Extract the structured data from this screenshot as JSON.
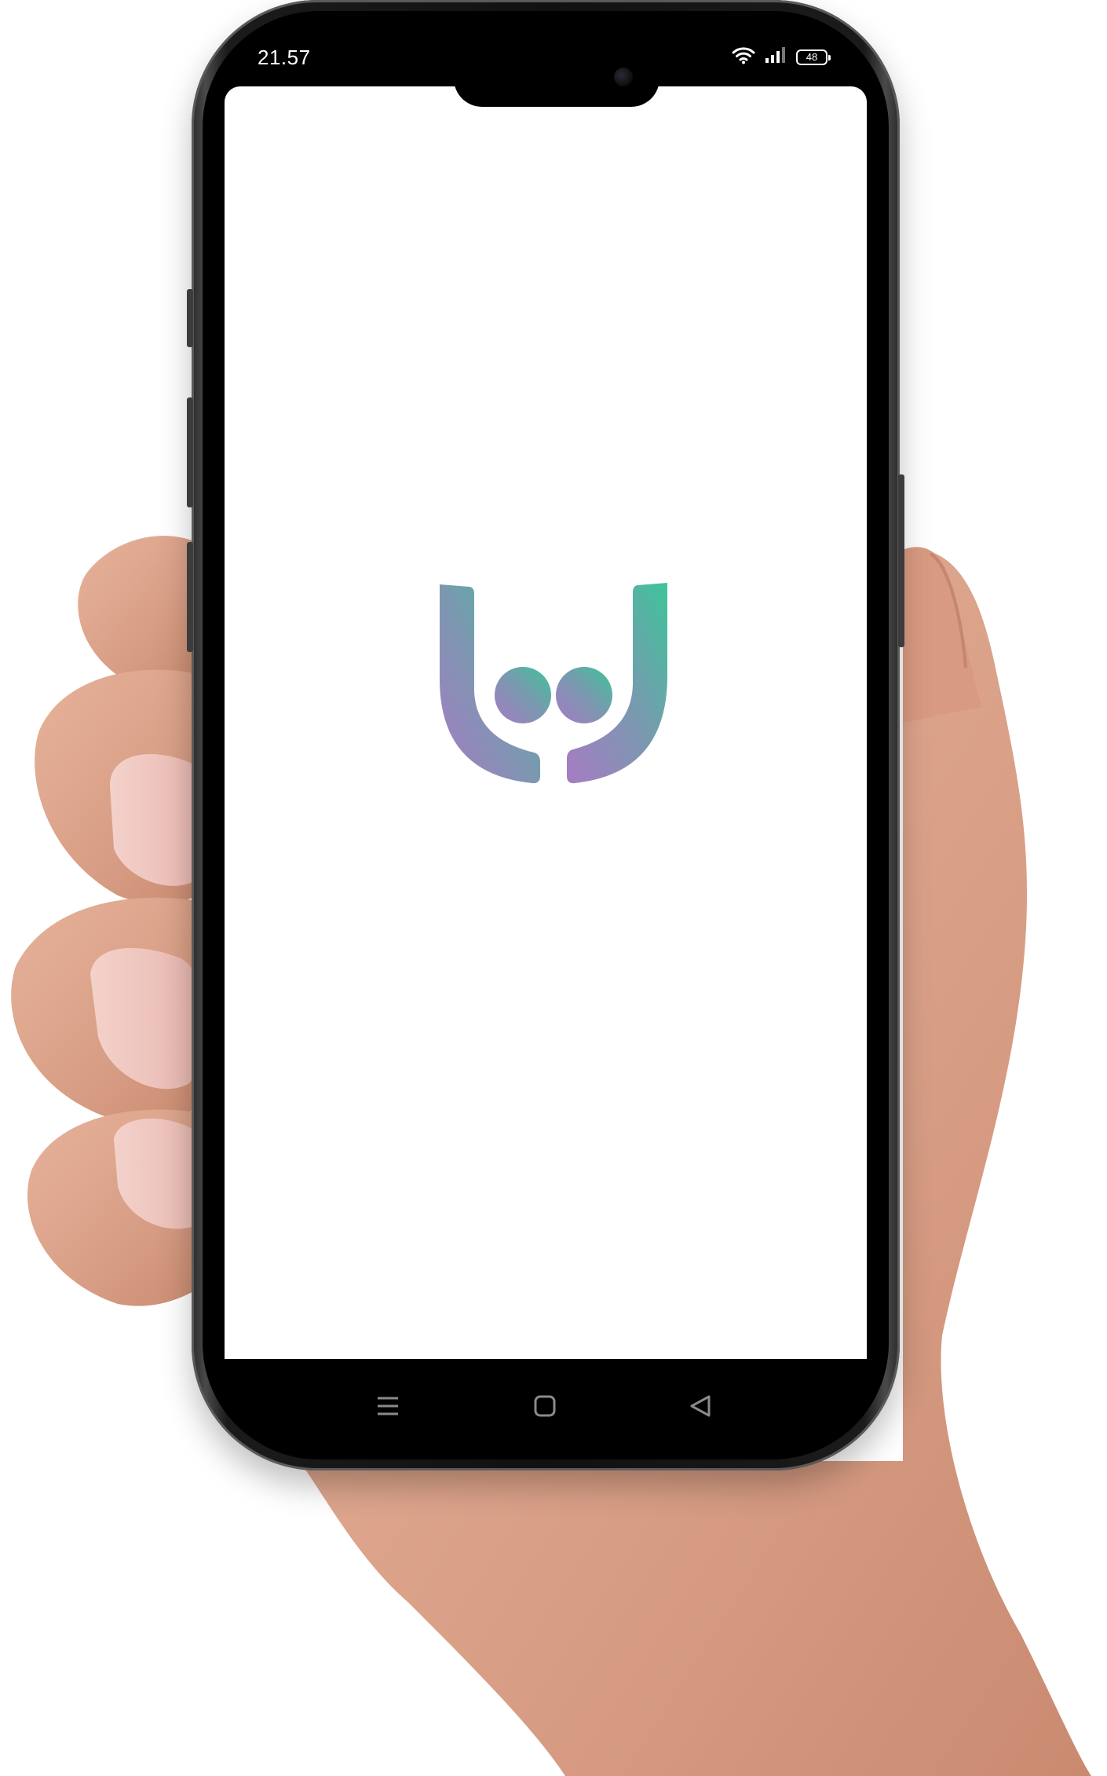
{
  "status_bar": {
    "time": "21.57",
    "battery_level": "48",
    "wifi_icon": "wifi-icon",
    "signal_icon": "cellular-signal-icon"
  },
  "splash": {
    "logo_icon": "app-logo-icon",
    "gradient_colors": [
      "#a77bc4",
      "#3ec49a"
    ]
  },
  "nav_bar": {
    "menu_icon": "menu-icon",
    "home_icon": "home-square-icon",
    "back_icon": "back-triangle-icon"
  }
}
